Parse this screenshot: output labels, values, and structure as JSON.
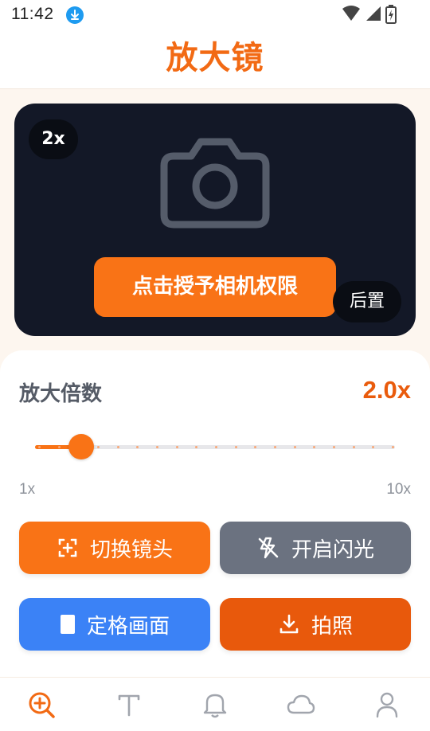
{
  "status_bar": {
    "time": "11:42",
    "icons": [
      "download-icon",
      "wifi-icon",
      "signal-icon",
      "battery-icon"
    ]
  },
  "header": {
    "title": "放大镜"
  },
  "preview": {
    "zoom_badge": "2x",
    "camera_icon": "camera-icon",
    "permission_button": "点击授予相机权限",
    "camera_facing": "后置"
  },
  "zoom": {
    "label": "放大倍数",
    "value_text": "2.0x",
    "value": 2.0,
    "min": 1,
    "max": 10,
    "min_label": "1x",
    "max_label": "10x"
  },
  "actions": {
    "switch_lens": {
      "label": "切换镜头",
      "icon": "switch-camera-icon",
      "color": "#f97316"
    },
    "flash": {
      "label": "开启闪光",
      "icon": "flash-off-icon",
      "color": "#6b7280"
    },
    "freeze": {
      "label": "定格画面",
      "icon": "freeze-icon",
      "color": "#3b82f6"
    },
    "capture": {
      "label": "拍照",
      "icon": "download-icon",
      "color": "#e8590c"
    }
  },
  "bottom_nav": {
    "active": "magnifier",
    "items": [
      {
        "id": "magnifier",
        "icon": "zoom-in-icon"
      },
      {
        "id": "text",
        "icon": "text-icon"
      },
      {
        "id": "reminder",
        "icon": "bell-icon"
      },
      {
        "id": "weather",
        "icon": "cloud-icon"
      },
      {
        "id": "profile",
        "icon": "user-icon"
      }
    ]
  },
  "colors": {
    "accent": "#f97316",
    "title": "#f26a14",
    "preview_bg": "#131827"
  }
}
